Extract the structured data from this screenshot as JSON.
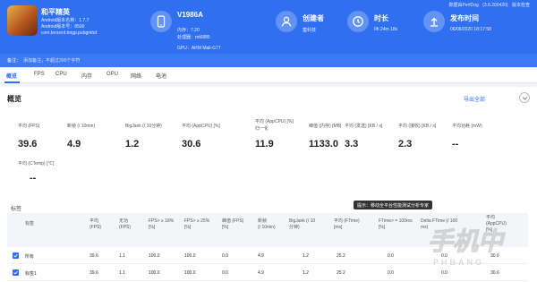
{
  "app": {
    "name": "和平精英",
    "version_name": "Android版本名称：1.7.7",
    "version_code": "Android版本号：8500",
    "package": "com.tencent.tmgp.pubgmhd"
  },
  "device": {
    "model": "V1986A",
    "memory": "内存：7.20",
    "cpu": "处理器：mt6885",
    "gpu": "GPU：ARM Mali-G77"
  },
  "creator": {
    "title": "创建者",
    "value": "蓋科技"
  },
  "duration": {
    "title": "时长",
    "value": "0h 24m 18s"
  },
  "published": {
    "title": "发布时间",
    "value": "06/06/2020 18:17:58"
  },
  "toolbar": {
    "items": [
      "数据由PerfDog",
      "(3.6.200420)",
      "版本检查"
    ]
  },
  "note": {
    "label": "备注：",
    "placeholder": "添加备注，不超过200个字符"
  },
  "tabs": [
    {
      "label": "概览",
      "active": true
    },
    {
      "label": "FPS"
    },
    {
      "label": "CPU"
    },
    {
      "label": "内存"
    },
    {
      "label": "GPU"
    },
    {
      "label": "网络"
    },
    {
      "label": "电池"
    }
  ],
  "overview": {
    "title": "概览",
    "export_label": "导出全部",
    "metrics_row1": [
      {
        "label": "平均 (FPS)",
        "value": "39.6"
      },
      {
        "label": "新帧 (/ 10min)",
        "value": "4.9"
      },
      {
        "label": "BigJank (/ 10分钟)",
        "value": "1.2"
      },
      {
        "label": "平均 (AppCPU) [%]",
        "value": "30.6"
      },
      {
        "label": "平均 (AppCPU) [%]",
        "label2": "归一化",
        "value": "11.9"
      },
      {
        "label": "峰值 (内存) [MB]",
        "value": "1133.0"
      },
      {
        "label": "平均 (发送) [KB / s]",
        "value": "3.3"
      },
      {
        "label": "平均 (接收) [KB / s]",
        "value": "2.3"
      },
      {
        "label": "平均功耗 (mW)",
        "value": "--"
      }
    ],
    "metrics_row2": [
      {
        "label": "平均 (CTemp) [℃]",
        "value": "--"
      }
    ]
  },
  "table": {
    "title": "标签",
    "tooltip": "提示：移动全平台性能测试分析专家",
    "headers": [
      "标签",
      "平均\n(FPS)",
      "无功\n(FPS)",
      "FPS> ≥ 18%\n[%]",
      "FPS> ≥ 25%\n[%]",
      "峰值 (FPS)\n[%]",
      "新帧\n(/ 10min)",
      "BigJank (/ 10\n分钟)",
      "平均 (FTime)\n[ms]",
      "FTime> = 100ms\n[%]",
      "Delta FTime (/ 100\nms)",
      "平均\n(AppCPU)\n[%]"
    ],
    "rows": [
      {
        "cells": [
          "所有",
          "39.6",
          "1.1",
          "100.0",
          "100.0",
          "0.0",
          "4.9",
          "1.2",
          "25.2",
          "0.0",
          "0.0",
          "30.6"
        ]
      },
      {
        "cells": [
          "标签1",
          "39.6",
          "1.1",
          "100.0",
          "100.0",
          "0.0",
          "4.9",
          "1.2",
          "25.2",
          "0.0",
          "0.0",
          "30.6"
        ]
      }
    ]
  },
  "watermark": {
    "main": "手机中",
    "sub": "PHBANG"
  },
  "colors": {
    "accent": "#2f6ff0"
  }
}
